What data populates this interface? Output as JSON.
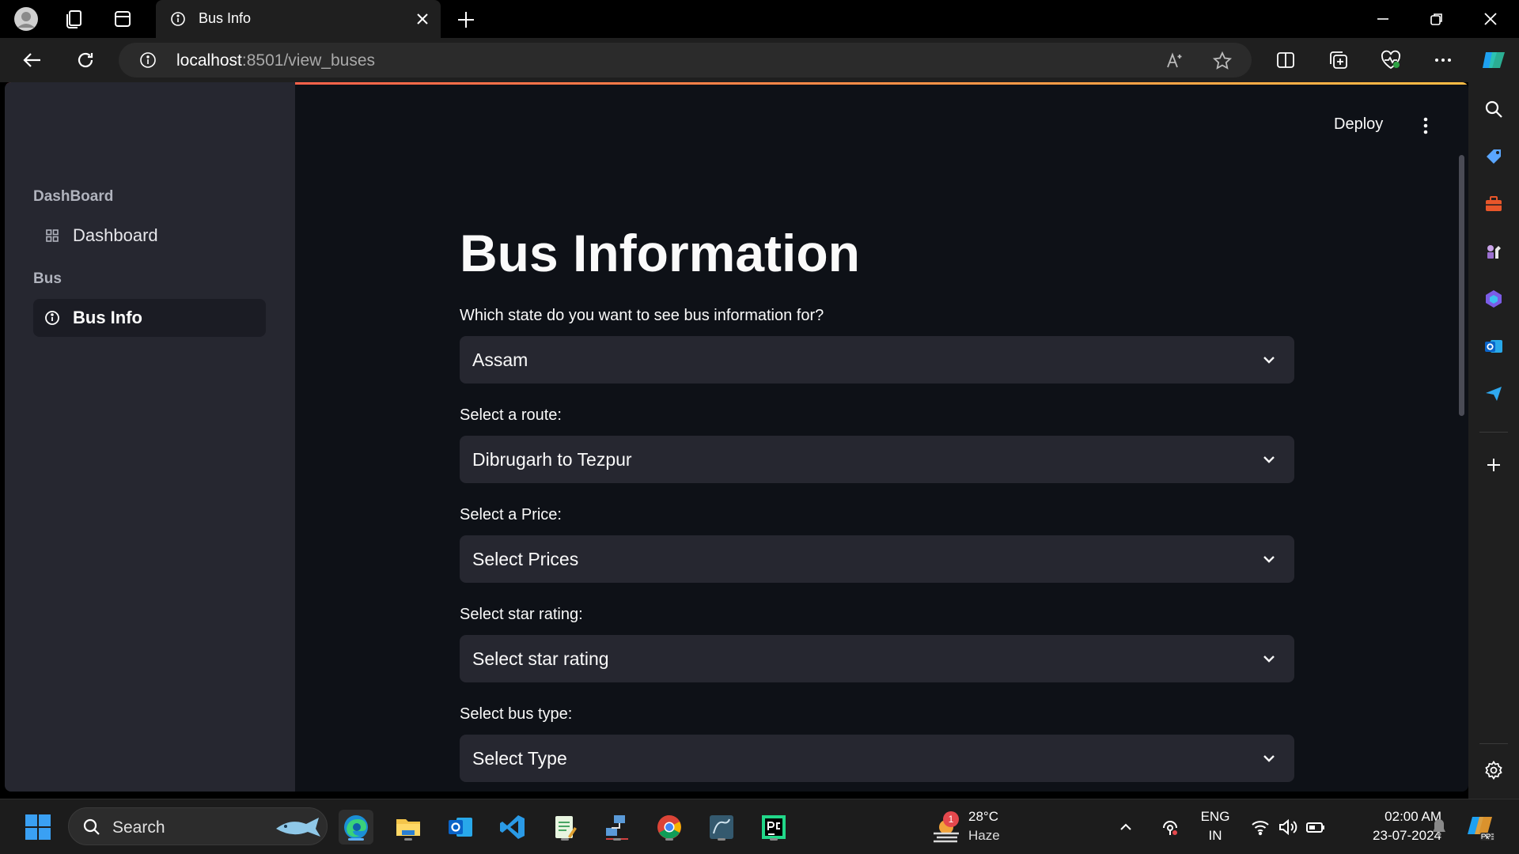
{
  "browser": {
    "tab_title": "Bus Info",
    "url_host": "localhost",
    "url_path": ":8501/view_buses"
  },
  "app": {
    "deploy_label": "Deploy",
    "sidebar": {
      "sections": [
        {
          "title": "DashBoard",
          "items": [
            {
              "label": "Dashboard",
              "icon": "dashboard-icon",
              "active": false
            }
          ]
        },
        {
          "title": "Bus",
          "items": [
            {
              "label": "Bus Info",
              "icon": "info-icon",
              "active": true
            }
          ]
        }
      ]
    },
    "page_title": "Bus Information",
    "fields": [
      {
        "label": "Which state do you want to see bus information for?",
        "value": "Assam"
      },
      {
        "label": "Select a route:",
        "value": "Dibrugarh to Tezpur"
      },
      {
        "label": "Select a Price:",
        "value": "Select Prices"
      },
      {
        "label": "Select star rating:",
        "value": "Select star rating"
      },
      {
        "label": "Select bus type:",
        "value": "Select Type"
      }
    ]
  },
  "taskbar": {
    "search_label": "Search",
    "weather": {
      "temp": "28°C",
      "desc": "Haze",
      "badge": "1"
    },
    "lang_line1": "ENG",
    "lang_line2": "IN",
    "time": "02:00 AM",
    "date": "23-07-2024"
  },
  "colors": {
    "app_bg": "#0e1117",
    "sidebar_bg": "#262730",
    "select_bg": "#262730",
    "accent_red": "#ff4b4b"
  }
}
